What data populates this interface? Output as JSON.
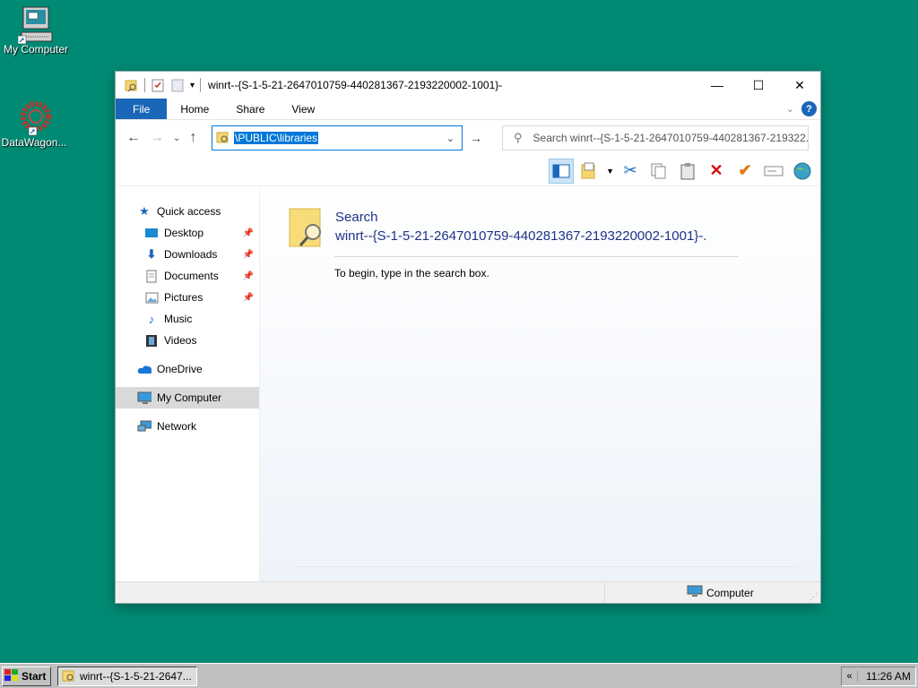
{
  "desktop": {
    "icons": [
      {
        "label": "My Computer",
        "icon": "computer-icon"
      },
      {
        "label": "DataWagon...",
        "icon": "gear-icon"
      }
    ]
  },
  "window": {
    "title": "winrt--{S-1-5-21-2647010759-440281367-2193220002-1001}-",
    "controls": {
      "minimize": "—",
      "maximize": "☐",
      "close": "✕"
    },
    "ribbon": {
      "tabs": [
        "File",
        "Home",
        "Share",
        "View"
      ],
      "help": "?"
    },
    "address": {
      "value": "\\PUBLIC\\libraries"
    },
    "search": {
      "placeholder": "Search winrt--{S-1-5-21-2647010759-440281367-219322..."
    },
    "navpane": {
      "quick_access": "Quick access",
      "pinned": [
        {
          "label": "Desktop",
          "pinned": true
        },
        {
          "label": "Downloads",
          "pinned": true
        },
        {
          "label": "Documents",
          "pinned": true
        },
        {
          "label": "Pictures",
          "pinned": true
        },
        {
          "label": "Music",
          "pinned": false
        },
        {
          "label": "Videos",
          "pinned": false
        }
      ],
      "onedrive": "OneDrive",
      "my_computer": "My Computer",
      "network": "Network"
    },
    "main": {
      "search_line1": "Search",
      "search_line2": "winrt--{S-1-5-21-2647010759-440281367-2193220002-1001}-.",
      "hint": "To begin, type in the search box."
    },
    "statusbar": {
      "location": "Computer"
    }
  },
  "taskbar": {
    "start": "Start",
    "task": "winrt--{S-1-5-21-2647...",
    "tray_arrow": "«",
    "time": "11:26 AM"
  },
  "colors": {
    "desktop": "#008a73",
    "accent": "#1a66b8",
    "search_title": "#1e3287"
  }
}
